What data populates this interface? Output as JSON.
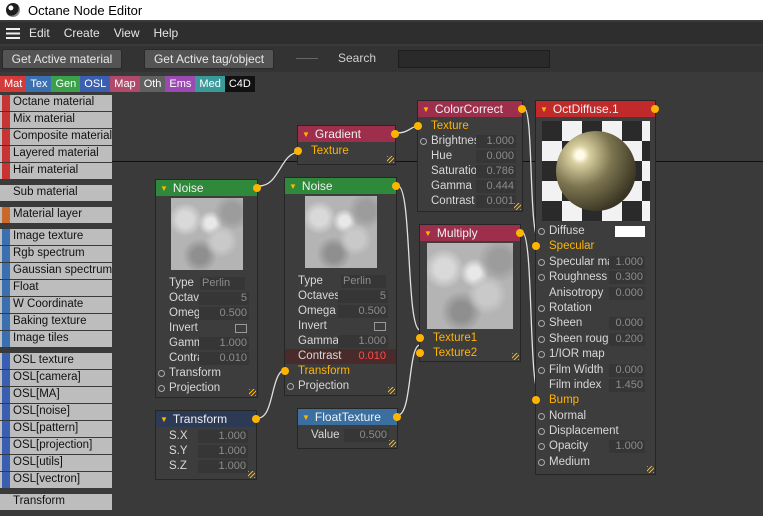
{
  "window": {
    "title": "Octane Node Editor"
  },
  "menu": [
    "Edit",
    "Create",
    "View",
    "Help"
  ],
  "toolbar": {
    "get_active_material": "Get Active material",
    "get_active_tag": "Get Active tag/object",
    "search_label": "Search",
    "search_value": ""
  },
  "categories": [
    {
      "label": "Mat",
      "color": "#d33a3a",
      "text": "#ffffff"
    },
    {
      "label": "Tex",
      "color": "#3a6fb0",
      "text": "#ffffff"
    },
    {
      "label": "Gen",
      "color": "#3aa04a",
      "text": "#ffffff"
    },
    {
      "label": "OSL",
      "color": "#3a5fb0",
      "text": "#ffffff"
    },
    {
      "label": "Map",
      "color": "#b04a6a",
      "text": "#ffffff"
    },
    {
      "label": "Oth",
      "color": "#606060",
      "text": "#ffffff"
    },
    {
      "label": "Ems",
      "color": "#9a4ab0",
      "text": "#ffffff"
    },
    {
      "label": "Med",
      "color": "#3a9a9a",
      "text": "#ffffff"
    },
    {
      "label": "C4D",
      "color": "#111111",
      "text": "#ffffff"
    }
  ],
  "sidebar": {
    "groups": [
      {
        "swatch": "#c83434",
        "items": [
          "Octane material",
          "Mix material",
          "Composite material",
          "Layered material",
          "Hair material"
        ]
      },
      {
        "swatch": "#bdbdbd",
        "items": [
          "Sub material"
        ]
      },
      {
        "swatch": "#c86b2a",
        "items": [
          "Material layer"
        ]
      },
      {
        "swatch": "#3a6fb0",
        "items": [
          "Image texture",
          "Rgb spectrum",
          "Gaussian spectrum",
          "Float",
          "W Coordinate",
          "Baking texture",
          "Image tiles"
        ]
      },
      {
        "swatch": "#3a5fb0",
        "items": [
          "OSL texture",
          "OSL[camera]",
          "OSL[MA]",
          "OSL[noise]",
          "OSL[pattern]",
          "OSL[projection]",
          "OSL[utils]",
          "OSL[vectron]"
        ]
      },
      {
        "swatch": "#bdbdbd",
        "items": [
          "Transform"
        ]
      }
    ]
  },
  "nodes": {
    "noise1": {
      "title": "Noise",
      "head_color": "#2e8a3a",
      "type_label": "Type",
      "type_value": "Perlin",
      "rows": [
        {
          "label": "Octaves",
          "value": "5"
        },
        {
          "label": "Omega",
          "value": "0.500"
        },
        {
          "label": "Invert",
          "value": ""
        },
        {
          "label": "Gamma",
          "value": "1.000"
        },
        {
          "label": "Contrast",
          "value": "0.010"
        }
      ],
      "inputs": [
        "Transform",
        "Projection"
      ]
    },
    "noise2": {
      "title": "Noise",
      "head_color": "#2e8a3a",
      "type_label": "Type",
      "type_value": "Perlin",
      "rows": [
        {
          "label": "Octaves",
          "value": "5"
        },
        {
          "label": "Omega",
          "value": "0.500"
        },
        {
          "label": "Invert",
          "value": ""
        },
        {
          "label": "Gamma",
          "value": "1.000"
        },
        {
          "label": "Contrast",
          "value": "0.010"
        }
      ],
      "inputs": [
        "Transform",
        "Projection"
      ]
    },
    "gradient": {
      "title": "Gradient",
      "head_color": "#9e2f4c",
      "input": "Texture"
    },
    "colorcorrect": {
      "title": "ColorCorrect",
      "head_color": "#9e2f4c",
      "input": "Texture",
      "rows": [
        {
          "label": "Brightness",
          "value": "1.000"
        },
        {
          "label": "Hue",
          "value": "0.000"
        },
        {
          "label": "Saturation",
          "value": "0.786"
        },
        {
          "label": "Gamma",
          "value": "0.444"
        },
        {
          "label": "Contrast",
          "value": "0.001"
        }
      ]
    },
    "multiply": {
      "title": "Multiply",
      "head_color": "#9e2f4c",
      "inputs": [
        "Texture1",
        "Texture2"
      ]
    },
    "transform": {
      "title": "Transform",
      "head_color": "#2c3a55",
      "rows": [
        {
          "label": "S.X",
          "value": "1.000"
        },
        {
          "label": "S.Y",
          "value": "1.000"
        },
        {
          "label": "S.Z",
          "value": "1.000"
        }
      ]
    },
    "floattexture": {
      "title": "FloatTexture",
      "head_color": "#3a6fa0",
      "label": "Value",
      "value": "0.500"
    },
    "octdiffuse": {
      "title": "OctDiffuse.1",
      "head_color": "#c02a2a",
      "rows": [
        {
          "label": "Diffuse",
          "value": "",
          "pin": "off",
          "color": true
        },
        {
          "label": "Specular",
          "value": "",
          "pin": "in",
          "on": true
        },
        {
          "label": "Specular map",
          "value": "1.000",
          "pin": "off"
        },
        {
          "label": "Roughness",
          "value": "0.300",
          "pin": "off"
        },
        {
          "label": "Anisotropy",
          "value": "0.000",
          "pin": "none"
        },
        {
          "label": "Rotation",
          "value": "",
          "pin": "off"
        },
        {
          "label": "Sheen",
          "value": "0.000",
          "pin": "off"
        },
        {
          "label": "Sheen roughness",
          "value": "0.200",
          "pin": "off"
        },
        {
          "label": "1/IOR map",
          "value": "",
          "pin": "off"
        },
        {
          "label": "Film Width",
          "value": "0.000",
          "pin": "off"
        },
        {
          "label": "Film index",
          "value": "1.450",
          "pin": "none"
        },
        {
          "label": "Bump",
          "value": "",
          "pin": "in",
          "on": true
        },
        {
          "label": "Normal",
          "value": "",
          "pin": "off"
        },
        {
          "label": "Displacement",
          "value": "",
          "pin": "off"
        },
        {
          "label": "Opacity",
          "value": "1.000",
          "pin": "off"
        },
        {
          "label": "Medium",
          "value": "",
          "pin": "off"
        }
      ]
    }
  }
}
